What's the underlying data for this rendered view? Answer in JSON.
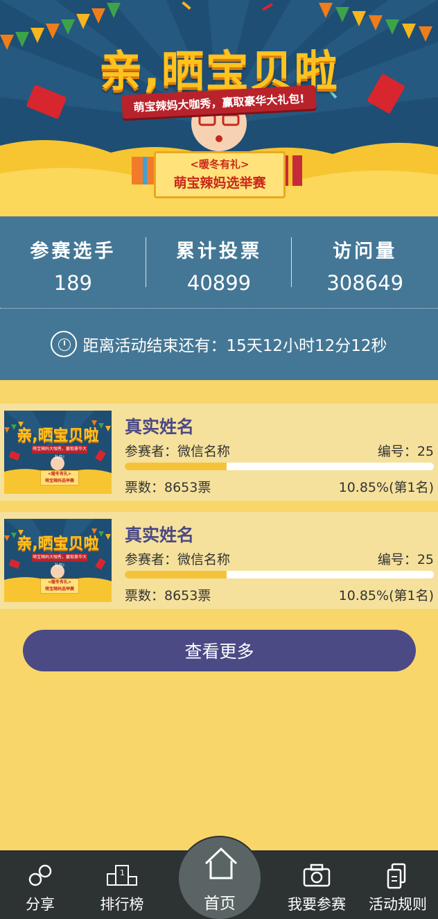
{
  "banner": {
    "title": "亲,晒宝贝啦",
    "ribbon": "萌宝辣妈大咖秀，赢取豪华大礼包!",
    "sign_sub": "<暖冬有礼>",
    "sign_main": "萌宝辣妈选举赛",
    "colors": {
      "sky": "#1e4e73",
      "title": "#ffc21e",
      "ribbon": "#b8232b"
    }
  },
  "stats": {
    "items": [
      {
        "label": "参赛选手",
        "value": "189"
      },
      {
        "label": "累计投票",
        "value": "40899"
      },
      {
        "label": "访问量",
        "value": "308649"
      }
    ],
    "countdown": "距离活动结束还有：15天12小时12分12秒",
    "countdown_icon": "clock-icon"
  },
  "entries": [
    {
      "name": "真实姓名",
      "player": "参赛者：微信名称",
      "number": "编号：25",
      "votes": "票数：8653票",
      "percent_text": "10.85%(第1名)",
      "progress_fraction": 0.33
    },
    {
      "name": "真实姓名",
      "player": "参赛者：微信名称",
      "number": "编号：25",
      "votes": "票数：8653票",
      "percent_text": "10.85%(第1名)",
      "progress_fraction": 0.33
    }
  ],
  "more_button": "查看更多",
  "tabbar": {
    "share": {
      "label": "分享",
      "icon": "share-icon"
    },
    "ranking": {
      "label": "排行榜",
      "icon": "podium-icon"
    },
    "home": {
      "label": "首页",
      "icon": "home-icon"
    },
    "join": {
      "label": "我要参赛",
      "icon": "camera-icon"
    },
    "rules": {
      "label": "活动规则",
      "icon": "document-icon"
    }
  },
  "colors": {
    "page_bg": "#f8d66a",
    "stats_bg": "#447795",
    "entry_bg": "#f5e19c",
    "accent": "#4b4a85",
    "progress": "#f5c33a",
    "tabbar": "#2d3232"
  }
}
